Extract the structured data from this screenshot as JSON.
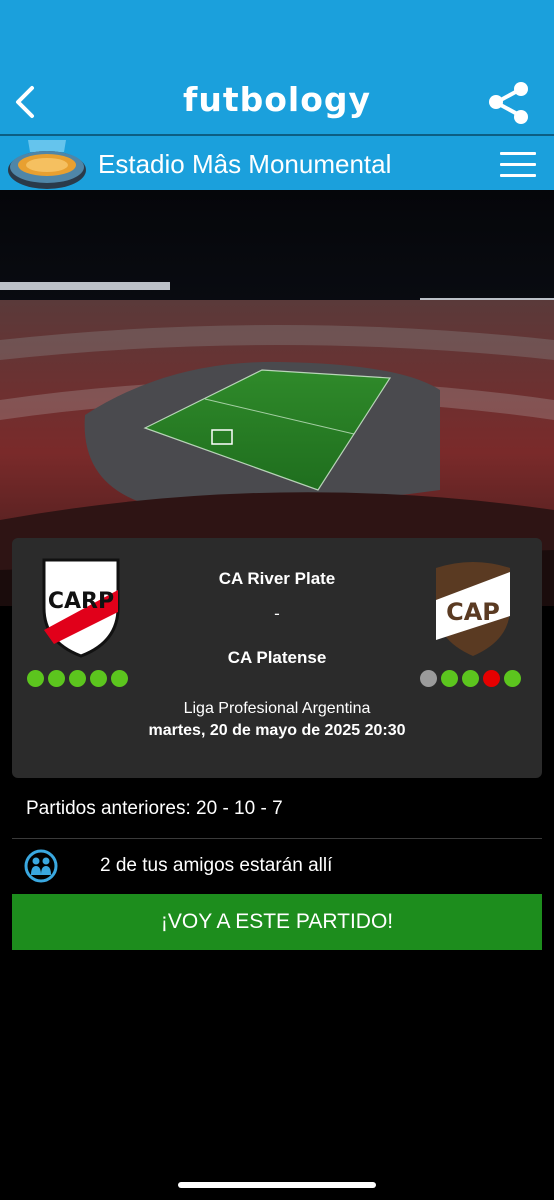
{
  "header": {
    "app_name": "futbology",
    "venue_name": "Estadio Mâs Monumental"
  },
  "match": {
    "home_team": "CA River Plate",
    "separator": "-",
    "away_team": "CA Platense",
    "home_crest_text": "CARP",
    "away_crest_text": "CAP",
    "home_form": [
      "#5cc51e",
      "#5cc51e",
      "#5cc51e",
      "#5cc51e",
      "#5cc51e"
    ],
    "away_form": [
      "#9b9b9b",
      "#5cc51e",
      "#5cc51e",
      "#e60000",
      "#5cc51e"
    ],
    "competition": "Liga Profesional Argentina",
    "datetime": "martes, 20 de mayo de 2025 20:30"
  },
  "history": {
    "label": "Partidos anteriores:  20 - 10 - 7"
  },
  "friends": {
    "text": "2 de tus amigos estarán allí"
  },
  "cta": {
    "label": "¡VOY A ESTE PARTIDO!"
  },
  "colors": {
    "brand": "#1ba0dc",
    "cta": "#1d8d1d",
    "card": "#2b2b2b"
  }
}
